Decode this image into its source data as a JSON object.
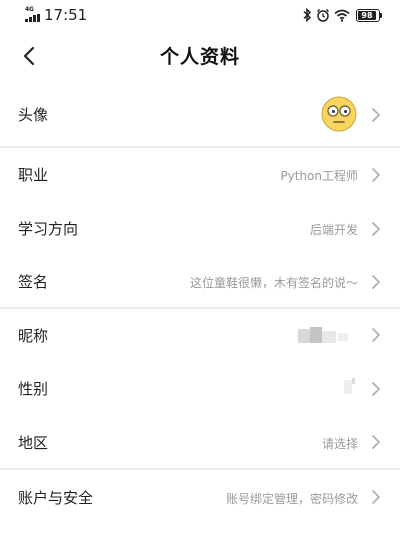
{
  "status_bar": {
    "network": "4G",
    "time": "17:51",
    "battery": "98",
    "icons": [
      "bluetooth-icon",
      "alarm-icon",
      "wifi-icon",
      "battery-icon"
    ]
  },
  "header": {
    "title": "个人资料",
    "back_icon": "chevron-left-icon"
  },
  "rows": {
    "avatar": {
      "label": "头像",
      "icon": "avatar-emoji"
    },
    "occupation": {
      "label": "职业",
      "value": "Python工程师"
    },
    "study_direction": {
      "label": "学习方向",
      "value": "后端开发"
    },
    "signature": {
      "label": "签名",
      "value": "这位童鞋很懒，木有签名的说～"
    },
    "nickname": {
      "label": "昵称",
      "value": ""
    },
    "gender": {
      "label": "性别",
      "value": ""
    },
    "region": {
      "label": "地区",
      "value": "请选择"
    },
    "account_security": {
      "label": "账户与安全",
      "value": "账号绑定管理，密码修改"
    }
  },
  "colors": {
    "text": "#222222",
    "secondary_text": "#9a9a9a",
    "divider": "#ececec",
    "chevron": "#b0b0b0",
    "avatar_face": "#f7d560"
  }
}
